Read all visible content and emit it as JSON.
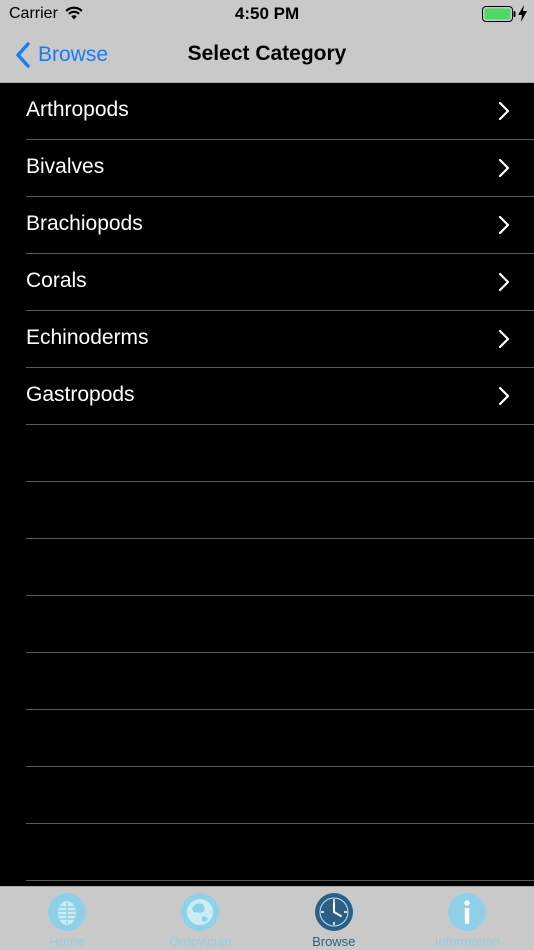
{
  "status_bar": {
    "carrier": "Carrier",
    "time": "4:50 PM",
    "battery_color": "#4cd964"
  },
  "nav_bar": {
    "back_label": "Browse",
    "title": "Select Category",
    "accent_color": "#1a7cf5"
  },
  "categories": [
    {
      "label": "Arthropods"
    },
    {
      "label": "Bivalves"
    },
    {
      "label": "Brachiopods"
    },
    {
      "label": "Corals"
    },
    {
      "label": "Echinoderms"
    },
    {
      "label": "Gastropods"
    }
  ],
  "tab_bar": {
    "tabs": [
      {
        "label": "Home",
        "icon": "trilobite-icon",
        "selected": false
      },
      {
        "label": "Ordovician",
        "icon": "globe-icon",
        "selected": false
      },
      {
        "label": "Browse",
        "icon": "clock-icon",
        "selected": true
      },
      {
        "label": "Information",
        "icon": "info-icon",
        "selected": false
      }
    ],
    "active_color": "#2b5f86",
    "inactive_color": "#8fd0e8"
  }
}
